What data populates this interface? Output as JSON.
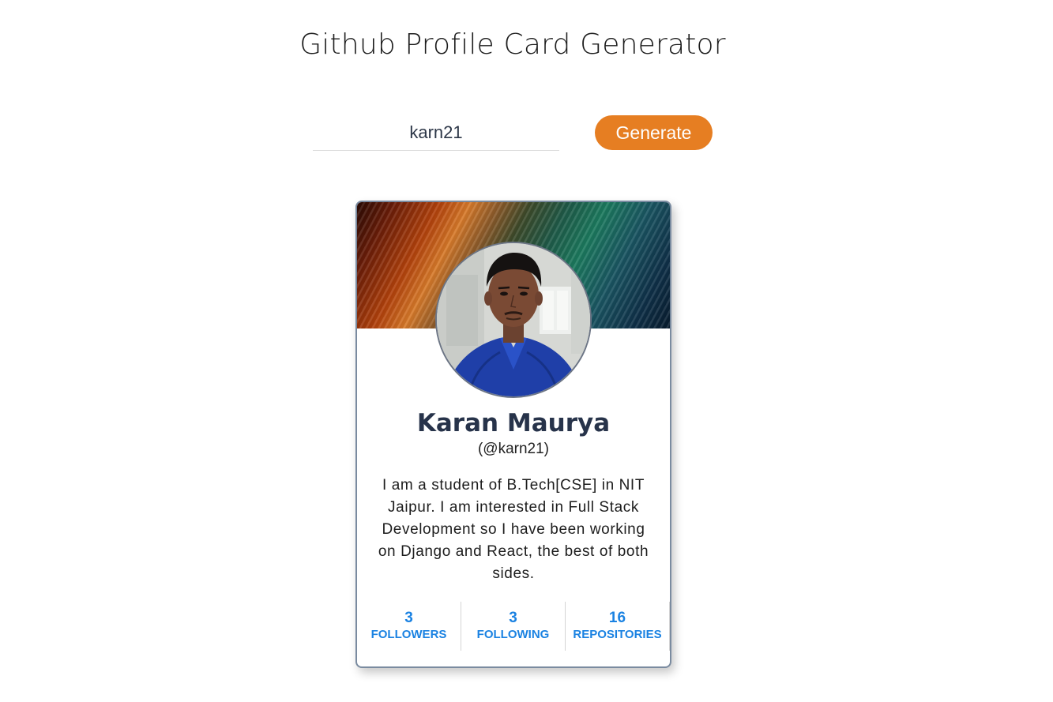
{
  "page": {
    "title": "Github Profile Card Generator"
  },
  "search": {
    "value": "karn21",
    "button_label": "Generate"
  },
  "colors": {
    "accent": "#e67e22",
    "stat_blue": "#1a82e2",
    "name_color": "#27334a"
  },
  "profile": {
    "name": "Karan Maurya",
    "handle": "(@karn21)",
    "bio": "I am a student of B.Tech[CSE] in NIT Jaipur. I am interested in Full Stack Development so I have been working on Django and React, the best of both sides.",
    "stats": [
      {
        "value": "3",
        "label": "FOLLOWERS"
      },
      {
        "value": "3",
        "label": "FOLLOWING"
      },
      {
        "value": "16",
        "label": "REPOSITORIES"
      }
    ]
  }
}
